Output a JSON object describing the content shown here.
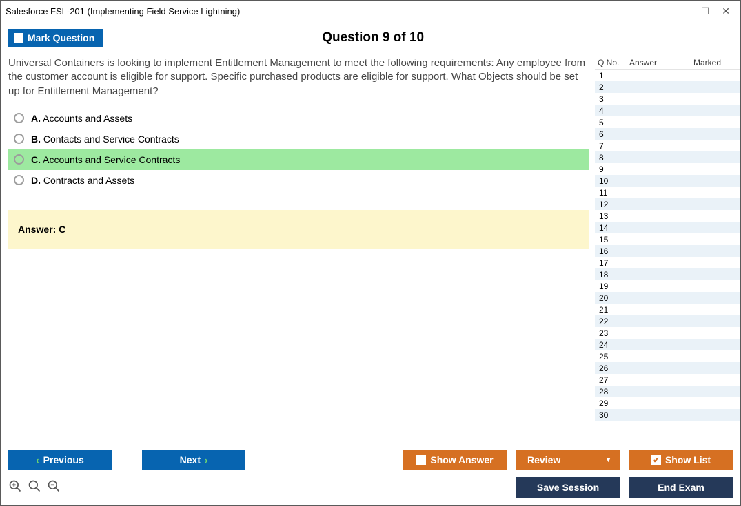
{
  "window": {
    "title": "Salesforce FSL-201 (Implementing Field Service Lightning)"
  },
  "header": {
    "mark_label": "Mark Question",
    "question_title": "Question 9 of 10"
  },
  "question": {
    "text": "Universal Containers is looking to implement Entitlement Management to meet the following requirements: Any employee from the customer account is eligible for support. Specific purchased products are eligible for support. What Objects should be set up for Entitlement Management?",
    "options": [
      {
        "letter": "A.",
        "text": "Accounts and Assets",
        "selected": false
      },
      {
        "letter": "B.",
        "text": "Contacts and Service Contracts",
        "selected": false
      },
      {
        "letter": "C.",
        "text": "Accounts and Service Contracts",
        "selected": true
      },
      {
        "letter": "D.",
        "text": "Contracts and Assets",
        "selected": false
      }
    ],
    "answer_label": "Answer: C"
  },
  "sidebar": {
    "cols": {
      "qno": "Q No.",
      "answer": "Answer",
      "marked": "Marked"
    },
    "rows": [
      1,
      2,
      3,
      4,
      5,
      6,
      7,
      8,
      9,
      10,
      11,
      12,
      13,
      14,
      15,
      16,
      17,
      18,
      19,
      20,
      21,
      22,
      23,
      24,
      25,
      26,
      27,
      28,
      29,
      30
    ]
  },
  "footer": {
    "previous": "Previous",
    "next": "Next",
    "show_answer": "Show Answer",
    "review": "Review",
    "show_list": "Show List",
    "save_session": "Save Session",
    "end_exam": "End Exam"
  }
}
